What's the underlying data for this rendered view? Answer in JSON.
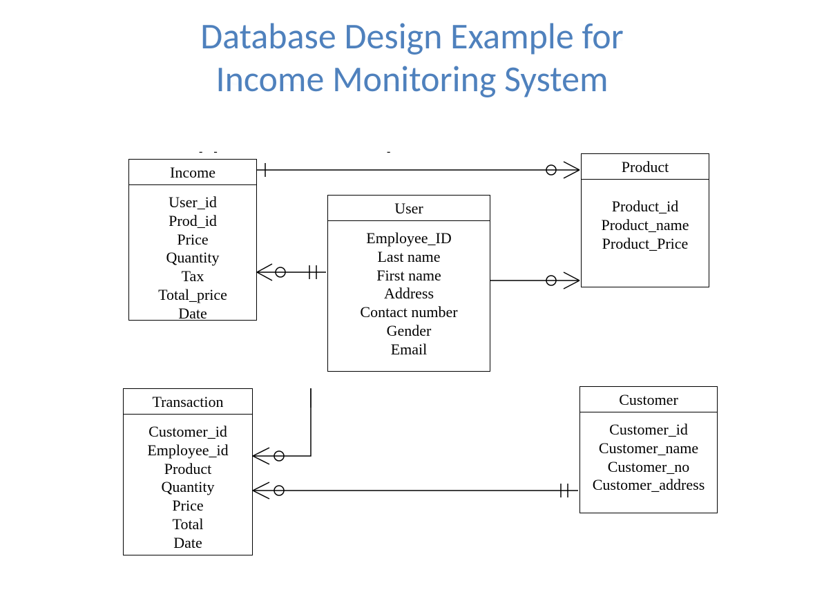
{
  "title": {
    "line1": "Database Design Example for",
    "line2": "Income Monitoring System"
  },
  "entities": {
    "income": {
      "name": "Income",
      "attrs": [
        "User_id",
        "Prod_id",
        "Price",
        "Quantity",
        "Tax",
        "Total_price",
        "Date"
      ]
    },
    "user": {
      "name": "User",
      "attrs": [
        "Employee_ID",
        "Last name",
        "First name",
        "Address",
        "Contact number",
        "Gender",
        "Email"
      ]
    },
    "product": {
      "name": "Product",
      "attrs": [
        "Product_id",
        "Product_name",
        "Product_Price"
      ]
    },
    "transaction": {
      "name": "Transaction",
      "attrs": [
        "Customer_id",
        "Employee_id",
        "Product",
        "Quantity",
        "Price",
        "Total",
        "Date"
      ]
    },
    "customer": {
      "name": "Customer",
      "attrs": [
        "Customer_id",
        "Customer_name",
        "Customer_no",
        "Customer_address"
      ]
    }
  },
  "relationships": [
    {
      "from": "Income",
      "to": "Product",
      "from_card": "one-mandatory",
      "to_card": "many-optional"
    },
    {
      "from": "Income",
      "to": "User",
      "from_card": "many-optional",
      "to_card": "one-mandatory"
    },
    {
      "from": "User",
      "to": "Product",
      "from_card": "one",
      "to_card": "many-optional"
    },
    {
      "from": "Transaction",
      "to": "User",
      "from_card": "many-optional",
      "to_card": "one"
    },
    {
      "from": "Transaction",
      "to": "Customer",
      "from_card": "many-optional",
      "to_card": "one-mandatory"
    }
  ]
}
